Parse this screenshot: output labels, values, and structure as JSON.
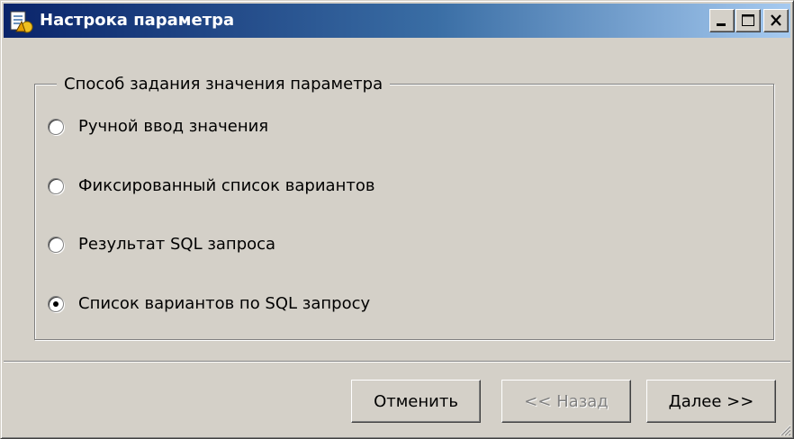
{
  "window": {
    "title": "Настрока параметра",
    "controls": {
      "minimize": "minimize-icon",
      "maximize": "maximize-icon",
      "close": "close-icon"
    }
  },
  "group": {
    "legend": "Способ задания значения параметра",
    "options": [
      {
        "label": "Ручной ввод значения",
        "checked": false
      },
      {
        "label": "Фиксированный список вариантов",
        "checked": false
      },
      {
        "label": "Результат SQL запроса",
        "checked": false
      },
      {
        "label": "Список вариантов по SQL запросу",
        "checked": true
      }
    ]
  },
  "buttons": {
    "cancel": "Отменить",
    "back": "<< Назад",
    "back_disabled": true,
    "next": "Далее >>"
  },
  "colors": {
    "face": "#d4d0c8",
    "title_start": "#0a246a",
    "title_end": "#a6caf0",
    "disabled_text": "#808080"
  }
}
